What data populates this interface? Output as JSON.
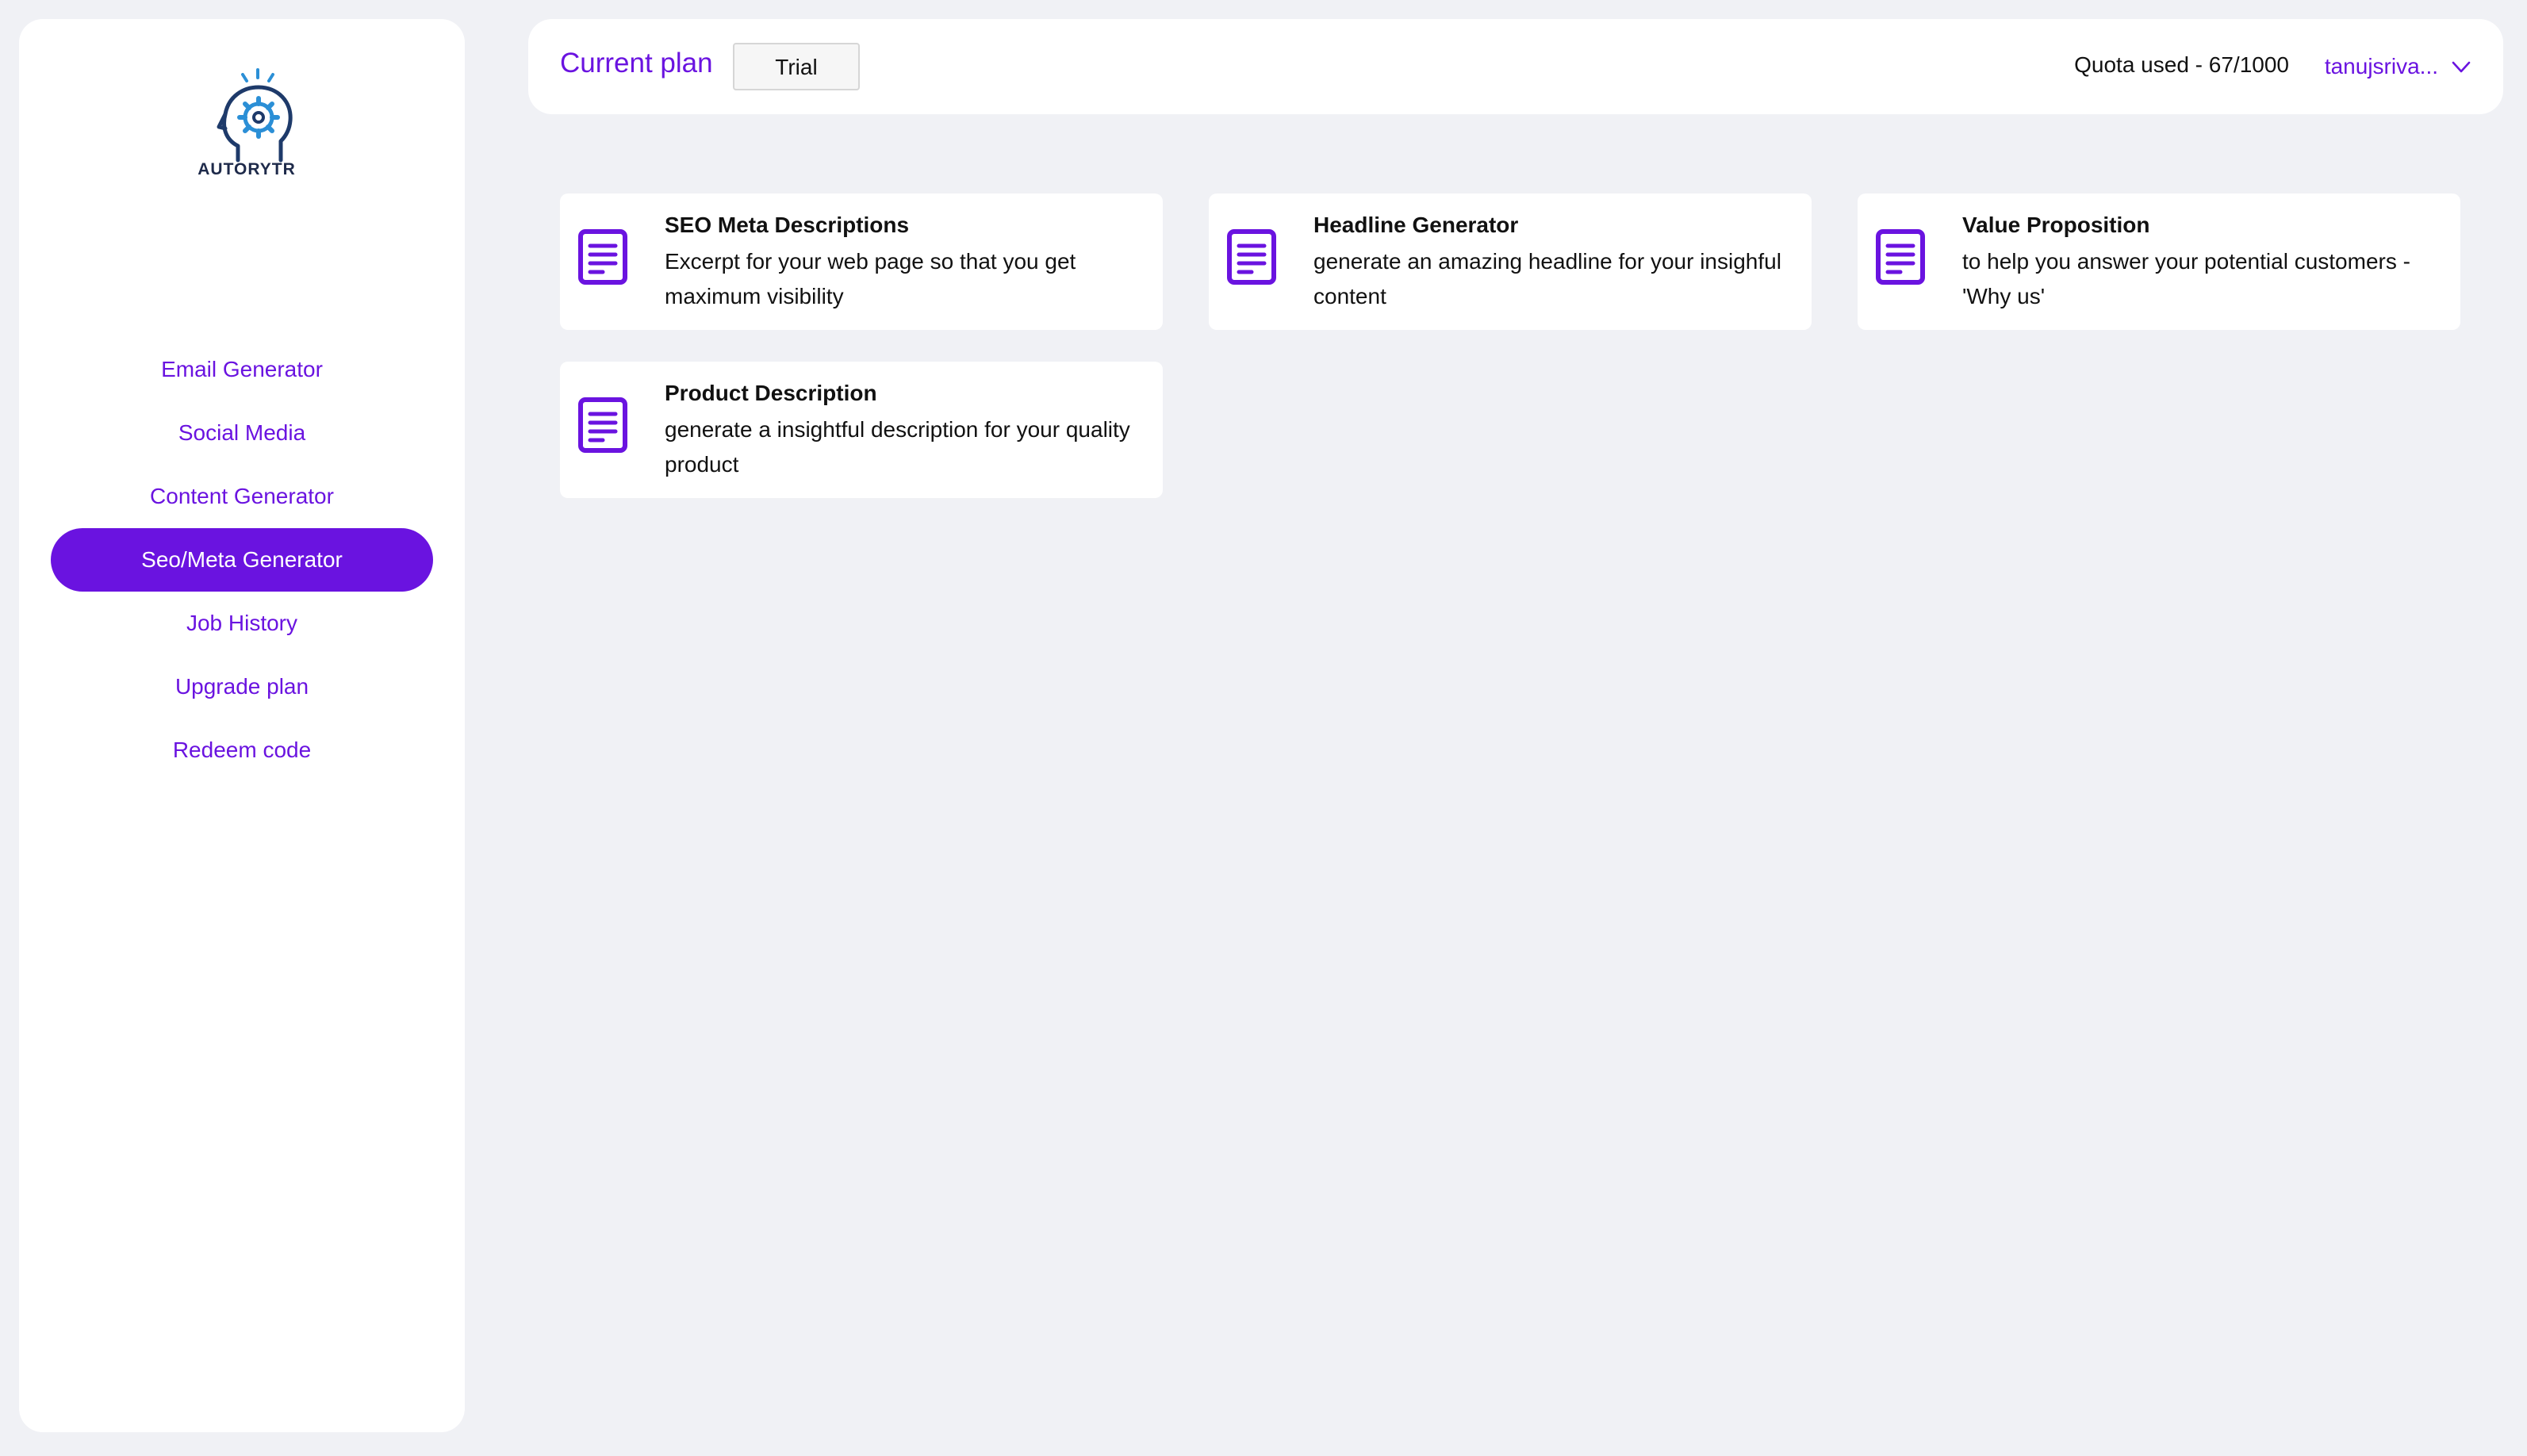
{
  "brand": {
    "name": "AUTORYTR",
    "logo_icon": "head-gear-icon",
    "accent_color": "#6a13e0"
  },
  "sidebar": {
    "items": [
      {
        "label": "Email Generator",
        "active": false
      },
      {
        "label": "Social Media",
        "active": false
      },
      {
        "label": "Content Generator",
        "active": false
      },
      {
        "label": "Seo/Meta Generator",
        "active": true
      },
      {
        "label": "Job History",
        "active": false
      },
      {
        "label": "Upgrade plan",
        "active": false
      },
      {
        "label": "Redeem code",
        "active": false
      }
    ]
  },
  "header": {
    "plan_label": "Current plan",
    "plan_value": "Trial",
    "quota": "Quota used - 67/1000",
    "user": "tanujsriva...",
    "user_menu_icon": "chevron-down-icon"
  },
  "cards": [
    {
      "icon": "document-icon",
      "title": "SEO Meta Descriptions",
      "description": "Excerpt for your web page so that you get maximum visibility"
    },
    {
      "icon": "document-icon",
      "title": "Headline Generator",
      "description": "generate an amazing headline for your insighful content"
    },
    {
      "icon": "document-icon",
      "title": "Value Proposition",
      "description": "to help you answer your potential customers - 'Why us'"
    },
    {
      "icon": "document-icon",
      "title": "Product Description",
      "description": "generate a insightful description for your quality product"
    }
  ]
}
